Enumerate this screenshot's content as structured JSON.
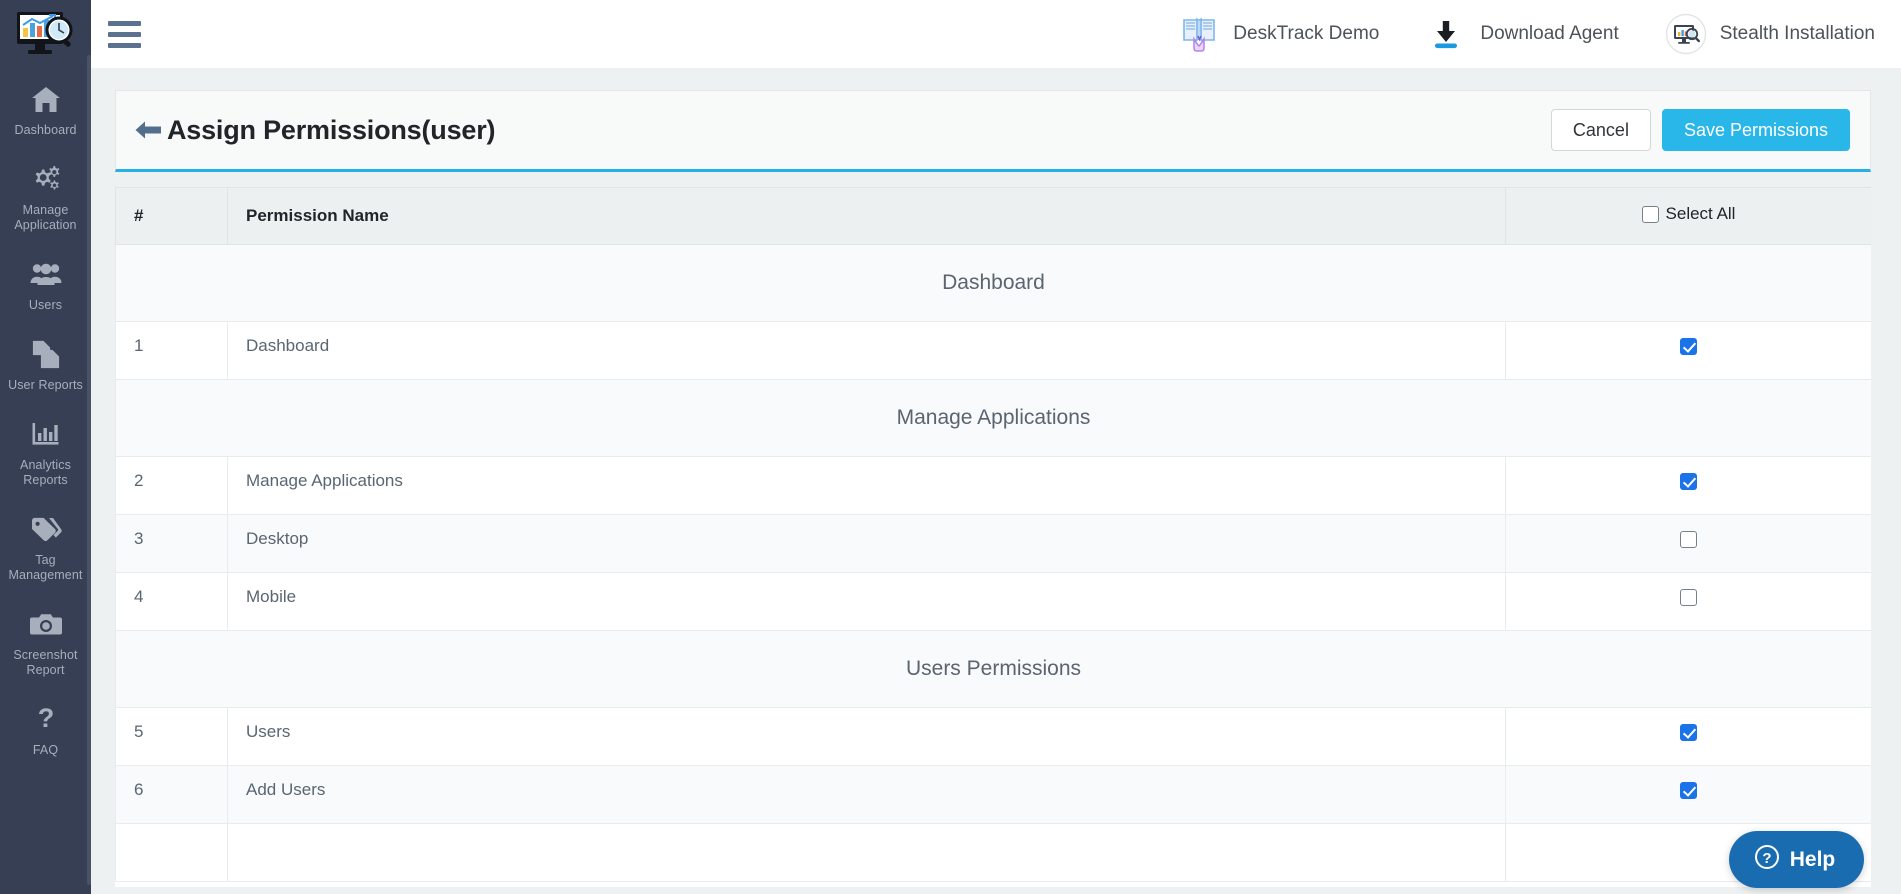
{
  "sidebar": {
    "logo_icon": "desktrack-logo-icon",
    "items": [
      {
        "label": "Dashboard",
        "icon": "home-icon"
      },
      {
        "label": "Manage Application",
        "icon": "gears-icon"
      },
      {
        "label": "Users",
        "icon": "users-group-icon"
      },
      {
        "label": "User Reports",
        "icon": "documents-copy-icon"
      },
      {
        "label": "Analytics Reports",
        "icon": "bar-chart-icon"
      },
      {
        "label": "Tag Management",
        "icon": "tags-icon"
      },
      {
        "label": "Screenshot Report",
        "icon": "camera-icon"
      },
      {
        "label": "FAQ",
        "icon": "question-mark-icon"
      }
    ]
  },
  "topbar": {
    "menu_toggle_icon": "hamburger-icon",
    "actions": [
      {
        "label": "DeskTrack Demo",
        "icon": "book-hand-icon"
      },
      {
        "label": "Download Agent",
        "icon": "download-icon"
      },
      {
        "label": "Stealth Installation",
        "icon": "stealth-monitor-icon"
      }
    ]
  },
  "page": {
    "back_icon": "back-arrow-icon",
    "title": "Assign Permissions(user)",
    "cancel_label": "Cancel",
    "save_label": "Save Permissions",
    "accent_color": "#29b6e8",
    "save_button_color": "#29b6e8"
  },
  "table": {
    "headers": {
      "number": "#",
      "name": "Permission Name",
      "select_all": "Select All",
      "select_all_checked": false
    },
    "rows": [
      {
        "type": "group",
        "label": "Dashboard"
      },
      {
        "type": "data",
        "num": "1",
        "name": "Dashboard",
        "checked": true
      },
      {
        "type": "group",
        "label": "Manage Applications"
      },
      {
        "type": "data",
        "num": "2",
        "name": "Manage Applications",
        "checked": true
      },
      {
        "type": "data",
        "num": "3",
        "name": "Desktop",
        "checked": false
      },
      {
        "type": "data",
        "num": "4",
        "name": "Mobile",
        "checked": false
      },
      {
        "type": "group",
        "label": "Users Permissions"
      },
      {
        "type": "data",
        "num": "5",
        "name": "Users",
        "checked": true
      },
      {
        "type": "data",
        "num": "6",
        "name": "Add Users",
        "checked": true
      },
      {
        "type": "data",
        "num": "",
        "name": "",
        "checked": false
      }
    ]
  },
  "help": {
    "label": "Help",
    "icon": "question-circle-icon",
    "color": "#1a6cb0"
  }
}
